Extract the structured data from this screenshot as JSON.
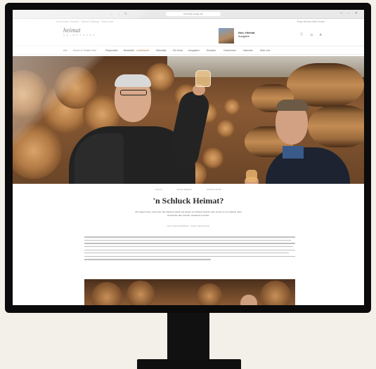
{
  "browser": {
    "nav_icons": "← → ↻",
    "url": "heimat-shop.de",
    "window_controls": "□ – ✕"
  },
  "site": {
    "topbar_left": "Kostenloser Versand · Sichere Zahlung · Treue-Club",
    "topbar_right": "Shop-Service   Mein Konto",
    "logo_main": "heimat",
    "logo_sub": "H E I M A T   S H O P",
    "promo_line1": "Neu: Heimat",
    "promo_line2": "Ausgabe",
    "header_icons": "♡ ⌂ ⌕",
    "menu": [
      "Alle",
      "Essen & Trinken",
      "Tirol",
      "Regionales",
      "Bestseller",
      "Landesweit",
      "Manufakt.",
      "Für Euch",
      "Ausgaben",
      "Rezepte",
      "Geschenke",
      "Kalender",
      "Über uns"
    ]
  },
  "article": {
    "breadcrumb": [
      "Heimat",
      "Heimat-Magazin",
      "Schluck Heimat"
    ],
    "title": "'n Schluck Heimat?",
    "lead": "Wir zeigen Ihnen, was hinter den Fässern steckt und warum ein Schluck Heimat mehr ist als nur ein Getränk. Eine Geschichte über Familie, Handwerk und Zeit.",
    "byline": "Text: Heimat Redaktion · Fotos: Heimat Shop"
  }
}
